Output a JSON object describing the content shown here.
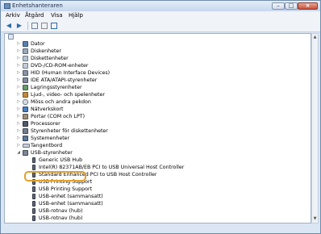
{
  "window": {
    "title": "Enhetshanteraren"
  },
  "menu": [
    "Arkiv",
    "Åtgärd",
    "Visa",
    "Hjälp"
  ],
  "toolbar": {
    "back": "back-icon",
    "forward": "forward-icon",
    "properties": "properties-icon",
    "scan": "scan-icon"
  },
  "tree": {
    "categories": [
      "Dator",
      "Diskenheter",
      "Diskettenheter",
      "DVD-/CD-ROM-enheter",
      "HID (Human Interface Devices)",
      "IDE ATA/ATAPI-styrenheter",
      "Lagringsstyrenheter",
      "Ljud-, video- och spelenheter",
      "Möss och andra pekdon",
      "Nätverkskort",
      "Portar (COM och LPT)",
      "Processorer",
      "Styrenheter för diskettenheter",
      "Systemenheter",
      "Tangentbord",
      "USB-styrenheter"
    ],
    "usb_children": [
      "Generic USB Hub",
      "Intel(R) 82371AB/EB PCI to USB Universal Host Controller",
      "Standard Enhanced PCI to USB Host Controller",
      "USB Printing Support",
      "USB Printing Support",
      "USB-enhet (sammansatt)",
      "USB-enhet (sammansatt)",
      "USB-rotnav (hub)",
      "USB-rotnav (hub)"
    ]
  },
  "colors": {
    "highlight": "#e3a12a",
    "accent": "#2f6ca6"
  }
}
